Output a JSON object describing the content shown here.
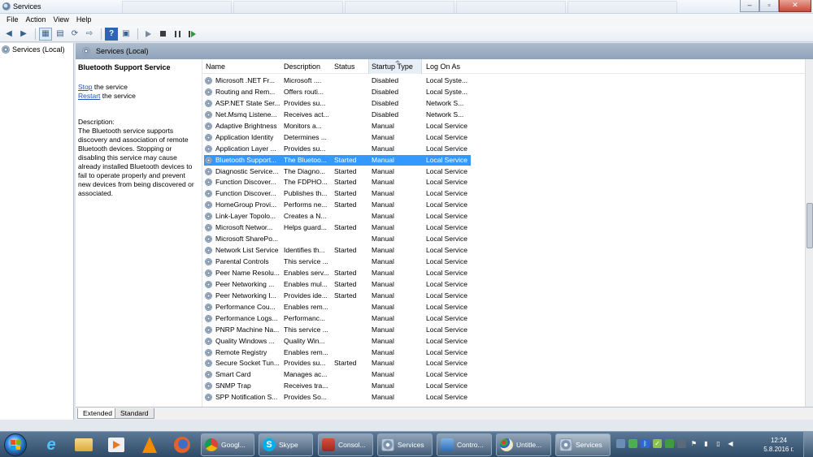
{
  "window": {
    "title": "Services",
    "controls": {
      "minimize": "–",
      "maximize": "▫",
      "close": "✕"
    }
  },
  "menu": [
    "File",
    "Action",
    "View",
    "Help"
  ],
  "tree": {
    "root": "Services (Local)"
  },
  "header": {
    "title": "Services (Local)"
  },
  "details": {
    "service_name": "Bluetooth Support Service",
    "stop_link": "Stop",
    "stop_suffix": " the service",
    "restart_link": "Restart",
    "restart_suffix": " the service",
    "description_label": "Description:",
    "description": "The Bluetooth service supports discovery and association of remote Bluetooth devices.  Stopping or disabling this service may cause already installed Bluetooth devices to fail to operate properly and prevent new devices from being discovered or associated."
  },
  "columns": {
    "name": "Name",
    "description": "Description",
    "status": "Status",
    "startup_type": "Startup Type",
    "log_on_as": "Log On As"
  },
  "rows": [
    {
      "name": "Microsoft .NET Fr...",
      "description": "Microsoft ....",
      "status": "",
      "startup": "Disabled",
      "logon": "Local Syste..."
    },
    {
      "name": "Routing and Rem...",
      "description": "Offers routi...",
      "status": "",
      "startup": "Disabled",
      "logon": "Local Syste..."
    },
    {
      "name": "ASP.NET State Ser...",
      "description": "Provides su...",
      "status": "",
      "startup": "Disabled",
      "logon": "Network S..."
    },
    {
      "name": "Net.Msmq Listene...",
      "description": "Receives act...",
      "status": "",
      "startup": "Disabled",
      "logon": "Network S..."
    },
    {
      "name": "Adaptive Brightness",
      "description": "Monitors a...",
      "status": "",
      "startup": "Manual",
      "logon": "Local Service"
    },
    {
      "name": "Application Identity",
      "description": "Determines ...",
      "status": "",
      "startup": "Manual",
      "logon": "Local Service"
    },
    {
      "name": "Application Layer ...",
      "description": "Provides su...",
      "status": "",
      "startup": "Manual",
      "logon": "Local Service"
    },
    {
      "name": "Bluetooth Support...",
      "description": "The Bluetoo...",
      "status": "Started",
      "startup": "Manual",
      "logon": "Local Service",
      "selected": true
    },
    {
      "name": "Diagnostic Service...",
      "description": "The Diagno...",
      "status": "Started",
      "startup": "Manual",
      "logon": "Local Service"
    },
    {
      "name": "Function Discover...",
      "description": "The FDPHO...",
      "status": "Started",
      "startup": "Manual",
      "logon": "Local Service"
    },
    {
      "name": "Function Discover...",
      "description": "Publishes th...",
      "status": "Started",
      "startup": "Manual",
      "logon": "Local Service"
    },
    {
      "name": "HomeGroup Provi...",
      "description": "Performs ne...",
      "status": "Started",
      "startup": "Manual",
      "logon": "Local Service"
    },
    {
      "name": "Link-Layer Topolo...",
      "description": "Creates a N...",
      "status": "",
      "startup": "Manual",
      "logon": "Local Service"
    },
    {
      "name": "Microsoft Networ...",
      "description": "Helps guard...",
      "status": "Started",
      "startup": "Manual",
      "logon": "Local Service"
    },
    {
      "name": "Microsoft SharePo...",
      "description": "",
      "status": "",
      "startup": "Manual",
      "logon": "Local Service"
    },
    {
      "name": "Network List Service",
      "description": "Identifies th...",
      "status": "Started",
      "startup": "Manual",
      "logon": "Local Service"
    },
    {
      "name": "Parental Controls",
      "description": "This service ...",
      "status": "",
      "startup": "Manual",
      "logon": "Local Service"
    },
    {
      "name": "Peer Name Resolu...",
      "description": "Enables serv...",
      "status": "Started",
      "startup": "Manual",
      "logon": "Local Service"
    },
    {
      "name": "Peer Networking ...",
      "description": "Enables mul...",
      "status": "Started",
      "startup": "Manual",
      "logon": "Local Service"
    },
    {
      "name": "Peer Networking I...",
      "description": "Provides ide...",
      "status": "Started",
      "startup": "Manual",
      "logon": "Local Service"
    },
    {
      "name": "Performance Cou...",
      "description": "Enables rem...",
      "status": "",
      "startup": "Manual",
      "logon": "Local Service"
    },
    {
      "name": "Performance Logs...",
      "description": "Performanc...",
      "status": "",
      "startup": "Manual",
      "logon": "Local Service"
    },
    {
      "name": "PNRP Machine Na...",
      "description": "This service ...",
      "status": "",
      "startup": "Manual",
      "logon": "Local Service"
    },
    {
      "name": "Quality Windows ...",
      "description": "Quality Win...",
      "status": "",
      "startup": "Manual",
      "logon": "Local Service"
    },
    {
      "name": "Remote Registry",
      "description": "Enables rem...",
      "status": "",
      "startup": "Manual",
      "logon": "Local Service"
    },
    {
      "name": "Secure Socket Tun...",
      "description": "Provides su...",
      "status": "Started",
      "startup": "Manual",
      "logon": "Local Service"
    },
    {
      "name": "Smart Card",
      "description": "Manages ac...",
      "status": "",
      "startup": "Manual",
      "logon": "Local Service"
    },
    {
      "name": "SNMP Trap",
      "description": "Receives tra...",
      "status": "",
      "startup": "Manual",
      "logon": "Local Service"
    },
    {
      "name": "SPP Notification S...",
      "description": "Provides So...",
      "status": "",
      "startup": "Manual",
      "logon": "Local Service"
    }
  ],
  "tabs": {
    "extended": "Extended",
    "standard": "Standard"
  },
  "taskbar": {
    "tasks": [
      "Googl...",
      "Skype",
      "Consol...",
      "Services",
      "Contro...",
      "Untitle...",
      "Services"
    ],
    "clock_time": "12:24",
    "clock_date": "5.8.2016 г."
  },
  "colors": {
    "selection": "#3399ff",
    "link": "#1f56b3",
    "taskbar": "#2e4a66"
  }
}
